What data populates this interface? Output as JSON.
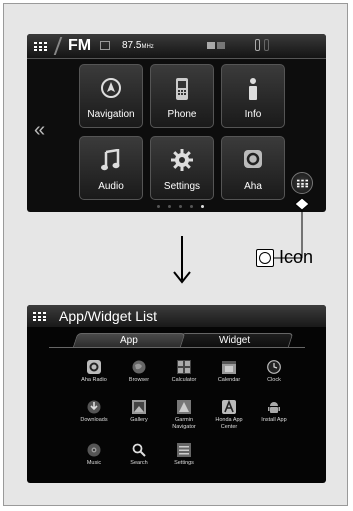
{
  "top_screen": {
    "status_bar": {
      "band": "FM",
      "frequency": "87.5",
      "frequency_unit": "MHz"
    },
    "tiles": [
      {
        "label": "Navigation",
        "icon": "navigation-icon"
      },
      {
        "label": "Phone",
        "icon": "phone-icon"
      },
      {
        "label": "Info",
        "icon": "info-icon"
      },
      {
        "label": "Audio",
        "icon": "music-note-icon"
      },
      {
        "label": "Settings",
        "icon": "gear-icon"
      },
      {
        "label": "Aha",
        "icon": "aha-icon"
      }
    ],
    "left_arrow_glyph": "«",
    "page_indicator": {
      "count": 5,
      "active": 5
    }
  },
  "callout": {
    "label": "Icon"
  },
  "bottom_screen": {
    "title": "App/Widget List",
    "tabs": [
      {
        "label": "App",
        "active": true
      },
      {
        "label": "Widget",
        "active": false
      }
    ],
    "apps": [
      {
        "label": "Aha Radio",
        "icon": "aha-icon"
      },
      {
        "label": "Browser",
        "icon": "globe-icon"
      },
      {
        "label": "Calculator",
        "icon": "calculator-icon"
      },
      {
        "label": "Calendar",
        "icon": "calendar-icon"
      },
      {
        "label": "Clock",
        "icon": "clock-icon"
      },
      {
        "label": "Downloads",
        "icon": "download-icon"
      },
      {
        "label": "Gallery",
        "icon": "gallery-icon"
      },
      {
        "label": "Garmin\nNavigator",
        "icon": "garmin-icon"
      },
      {
        "label": "Honda App\nCenter",
        "icon": "honda-app-center-icon"
      },
      {
        "label": "Install App",
        "icon": "android-icon"
      },
      {
        "label": "Music",
        "icon": "music-disc-icon"
      },
      {
        "label": "Search",
        "icon": "search-icon"
      },
      {
        "label": "Settings",
        "icon": "settings-icon"
      }
    ]
  },
  "colors": {
    "screen_bg": "#0d0d0d",
    "frame_bg": "#e6e6e6",
    "label": "#ffffff"
  }
}
